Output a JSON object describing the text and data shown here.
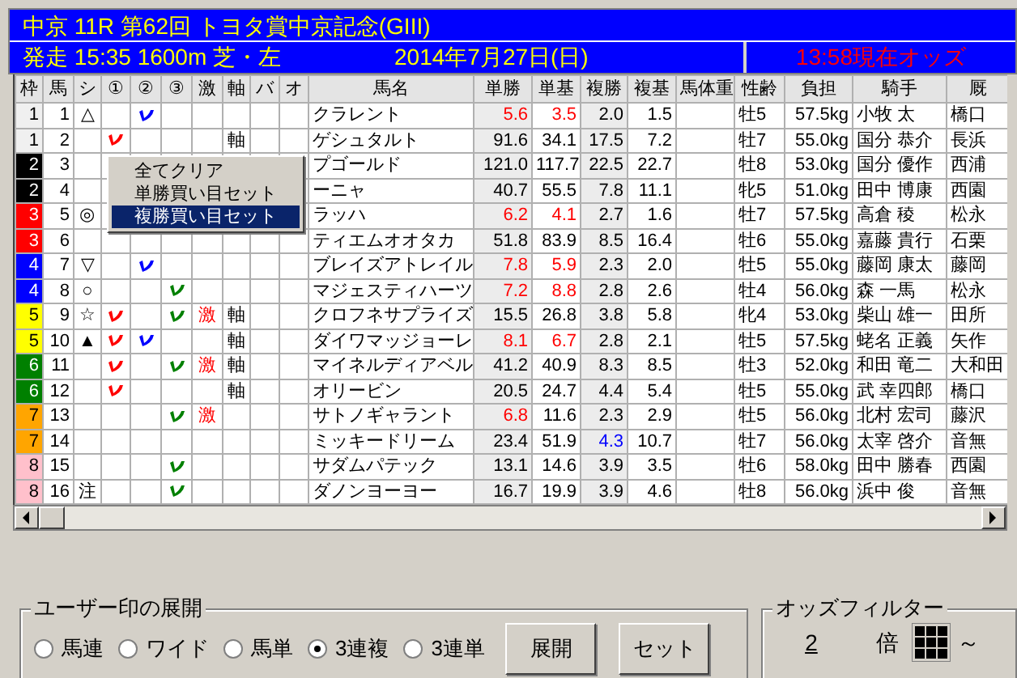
{
  "race": {
    "title": "中京 11R 第62回 トヨタ賞中京記念(GIII)",
    "start": "発走 15:35 1600m 芝・左",
    "date": "2014年7月27日(日)",
    "odds_time": "13:58現在オッズ"
  },
  "table": {
    "columns": [
      "枠",
      "馬",
      "シ",
      "①",
      "②",
      "③",
      "激",
      "軸",
      "バ",
      "オ",
      "馬名",
      "単勝",
      "単基",
      "複勝",
      "複基",
      "馬体重",
      "性齢",
      "負担",
      "騎手",
      "厩"
    ],
    "rows": [
      {
        "frame": "1",
        "color": "#f0f0f0",
        "num": "1",
        "mark": "△",
        "c1": false,
        "c2": true,
        "c3": false,
        "name": "クラレント",
        "win": {
          "text": "5.6",
          "color": "#ff0000"
        },
        "win_base": {
          "text": "3.5",
          "color": "#ff0000"
        },
        "place": {
          "text": "2.0",
          "color": "#000000"
        },
        "place_base": "1.5",
        "sex_age": "牡5",
        "weight": "57.5kg",
        "jockey": "小牧 太",
        "trainer": "橋口"
      },
      {
        "frame": "1",
        "color": "#f0f0f0",
        "num": "2",
        "c1": true,
        "c2": false,
        "c3": false,
        "axis": "軸",
        "name": "ゲシュタルト",
        "win": {
          "text": "91.6",
          "color": "#000000"
        },
        "win_base": {
          "text": "34.1",
          "color": "#000000"
        },
        "place": {
          "text": "17.5",
          "color": "#000000"
        },
        "place_base": "7.2",
        "sex_age": "牡7",
        "weight": "55.0kg",
        "jockey": "国分 恭介",
        "trainer": "長浜"
      },
      {
        "frame": "2",
        "color": "#000000",
        "num": "3",
        "c1": false,
        "c2": false,
        "c3": false,
        "name": "プゴールド",
        "win": {
          "text": "121.0",
          "color": "#000000"
        },
        "win_base": {
          "text": "117.7",
          "color": "#000000"
        },
        "place": {
          "text": "22.5",
          "color": "#000000"
        },
        "place_base": "22.7",
        "sex_age": "牡8",
        "weight": "53.0kg",
        "jockey": "国分 優作",
        "trainer": "西浦"
      },
      {
        "frame": "2",
        "color": "#000000",
        "num": "4",
        "c1": false,
        "c2": false,
        "c3": false,
        "name": "ーニャ",
        "win": {
          "text": "40.7",
          "color": "#000000"
        },
        "win_base": {
          "text": "55.5",
          "color": "#000000"
        },
        "place": {
          "text": "7.8",
          "color": "#000000"
        },
        "place_base": "11.1",
        "sex_age": "牝5",
        "weight": "51.0kg",
        "jockey": "田中 博康",
        "trainer": "西園"
      },
      {
        "frame": "3",
        "color": "#ff0000",
        "num": "5",
        "mark": "◎",
        "c1": false,
        "c2": false,
        "c3": false,
        "name": "ラッハ",
        "win": {
          "text": "6.2",
          "color": "#ff0000"
        },
        "win_base": {
          "text": "4.1",
          "color": "#ff0000"
        },
        "place": {
          "text": "2.7",
          "color": "#000000"
        },
        "place_base": "1.6",
        "sex_age": "牡7",
        "weight": "57.5kg",
        "jockey": "高倉 稜",
        "trainer": "松永"
      },
      {
        "frame": "3",
        "color": "#ff0000",
        "num": "6",
        "c1": false,
        "c2": false,
        "c3": false,
        "name": "ティエムオオタカ",
        "win": {
          "text": "51.8",
          "color": "#000000"
        },
        "win_base": {
          "text": "83.9",
          "color": "#000000"
        },
        "place": {
          "text": "8.5",
          "color": "#000000"
        },
        "place_base": "16.4",
        "sex_age": "牡6",
        "weight": "55.0kg",
        "jockey": "嘉藤 貴行",
        "trainer": "石栗"
      },
      {
        "frame": "4",
        "color": "#0000ff",
        "num": "7",
        "mark": "▽",
        "c1": false,
        "c2": true,
        "c3": false,
        "name": "ブレイズアトレイル",
        "win": {
          "text": "7.8",
          "color": "#ff0000"
        },
        "win_base": {
          "text": "5.9",
          "color": "#ff0000"
        },
        "place": {
          "text": "2.3",
          "color": "#000000"
        },
        "place_base": "2.0",
        "sex_age": "牡5",
        "weight": "55.0kg",
        "jockey": "藤岡 康太",
        "trainer": "藤岡"
      },
      {
        "frame": "4",
        "color": "#0000ff",
        "num": "8",
        "mark": "○",
        "c1": false,
        "c2": false,
        "c3": true,
        "name": "マジェスティハーツ",
        "win": {
          "text": "7.2",
          "color": "#ff0000"
        },
        "win_base": {
          "text": "8.8",
          "color": "#ff0000"
        },
        "place": {
          "text": "2.8",
          "color": "#000000"
        },
        "place_base": "2.6",
        "sex_age": "牡4",
        "weight": "56.0kg",
        "jockey": "森 一馬",
        "trainer": "松永"
      },
      {
        "frame": "5",
        "color": "#ffff00",
        "num": "9",
        "mark": "☆",
        "c1": true,
        "c2": false,
        "c3": true,
        "hot": "激",
        "axis": "軸",
        "name": "クロフネサプライズ",
        "win": {
          "text": "15.5",
          "color": "#000000"
        },
        "win_base": {
          "text": "26.8",
          "color": "#000000"
        },
        "place": {
          "text": "3.8",
          "color": "#000000"
        },
        "place_base": "5.8",
        "sex_age": "牝4",
        "weight": "53.0kg",
        "jockey": "柴山 雄一",
        "trainer": "田所"
      },
      {
        "frame": "5",
        "color": "#ffff00",
        "num": "10",
        "mark": "▲",
        "c1": true,
        "c2": true,
        "c3": false,
        "axis": "軸",
        "name": "ダイワマッジョーレ",
        "win": {
          "text": "8.1",
          "color": "#ff0000"
        },
        "win_base": {
          "text": "6.7",
          "color": "#ff0000"
        },
        "place": {
          "text": "2.8",
          "color": "#000000"
        },
        "place_base": "2.1",
        "sex_age": "牡5",
        "weight": "57.5kg",
        "jockey": "蛯名 正義",
        "trainer": "矢作"
      },
      {
        "frame": "6",
        "color": "#008000",
        "num": "11",
        "c1": true,
        "c2": false,
        "c3": true,
        "hot": "激",
        "axis": "軸",
        "name": "マイネルディアベル",
        "win": {
          "text": "41.2",
          "color": "#000000"
        },
        "win_base": {
          "text": "40.9",
          "color": "#000000"
        },
        "place": {
          "text": "8.3",
          "color": "#000000"
        },
        "place_base": "8.5",
        "sex_age": "牡3",
        "weight": "52.0kg",
        "jockey": "和田 竜二",
        "trainer": "大和田"
      },
      {
        "frame": "6",
        "color": "#008000",
        "num": "12",
        "c1": true,
        "c2": false,
        "c3": false,
        "axis": "軸",
        "name": "オリービン",
        "win": {
          "text": "20.5",
          "color": "#000000"
        },
        "win_base": {
          "text": "24.7",
          "color": "#000000"
        },
        "place": {
          "text": "4.4",
          "color": "#000000"
        },
        "place_base": "5.4",
        "sex_age": "牡5",
        "weight": "55.0kg",
        "jockey": "武 幸四郎",
        "trainer": "橋口"
      },
      {
        "frame": "7",
        "color": "#ffa500",
        "num": "13",
        "c1": false,
        "c2": false,
        "c3": true,
        "hot": "激",
        "name": "サトノギャラント",
        "win": {
          "text": "6.8",
          "color": "#ff0000"
        },
        "win_base": {
          "text": "11.6",
          "color": "#000000"
        },
        "place": {
          "text": "2.3",
          "color": "#000000"
        },
        "place_base": "2.9",
        "sex_age": "牡5",
        "weight": "56.0kg",
        "jockey": "北村 宏司",
        "trainer": "藤沢"
      },
      {
        "frame": "7",
        "color": "#ffa500",
        "num": "14",
        "c1": false,
        "c2": false,
        "c3": false,
        "name": "ミッキードリーム",
        "win": {
          "text": "23.4",
          "color": "#000000"
        },
        "win_base": {
          "text": "51.9",
          "color": "#000000"
        },
        "place": {
          "text": "4.3",
          "color": "#0000ff"
        },
        "place_base": "10.7",
        "sex_age": "牡7",
        "weight": "56.0kg",
        "jockey": "太宰 啓介",
        "trainer": "音無"
      },
      {
        "frame": "8",
        "color": "#ffc0cb",
        "num": "15",
        "c1": false,
        "c2": false,
        "c3": true,
        "name": "サダムパテック",
        "win": {
          "text": "13.1",
          "color": "#000000"
        },
        "win_base": {
          "text": "14.6",
          "color": "#000000"
        },
        "place": {
          "text": "3.9",
          "color": "#000000"
        },
        "place_base": "3.5",
        "sex_age": "牡6",
        "weight": "58.0kg",
        "jockey": "田中 勝春",
        "trainer": "西園"
      },
      {
        "frame": "8",
        "color": "#ffc0cb",
        "num": "16",
        "mark": "注",
        "c1": false,
        "c2": false,
        "c3": true,
        "name": "ダノンヨーヨー",
        "win": {
          "text": "16.7",
          "color": "#000000"
        },
        "win_base": {
          "text": "19.9",
          "color": "#000000"
        },
        "place": {
          "text": "3.9",
          "color": "#000000"
        },
        "place_base": "4.6",
        "sex_age": "牡8",
        "weight": "56.0kg",
        "jockey": "浜中 俊",
        "trainer": "音無"
      }
    ]
  },
  "context_menu": {
    "items": [
      {
        "label": "全てクリア",
        "selected": false
      },
      {
        "label": "単勝買い目セット",
        "selected": false
      },
      {
        "label": "複勝買い目セット",
        "selected": true
      }
    ]
  },
  "user_marks": {
    "title": "ユーザー印の展開",
    "options": [
      {
        "label": "馬連",
        "selected": false
      },
      {
        "label": "ワイド",
        "selected": false
      },
      {
        "label": "馬単",
        "selected": false
      },
      {
        "label": "3連複",
        "selected": true
      },
      {
        "label": "3連単",
        "selected": false
      }
    ],
    "buttons": [
      "展開",
      "セット"
    ]
  },
  "odds_filter": {
    "title": "オッズフィルター",
    "value": "2",
    "unit": "倍",
    "tilde": "～"
  }
}
